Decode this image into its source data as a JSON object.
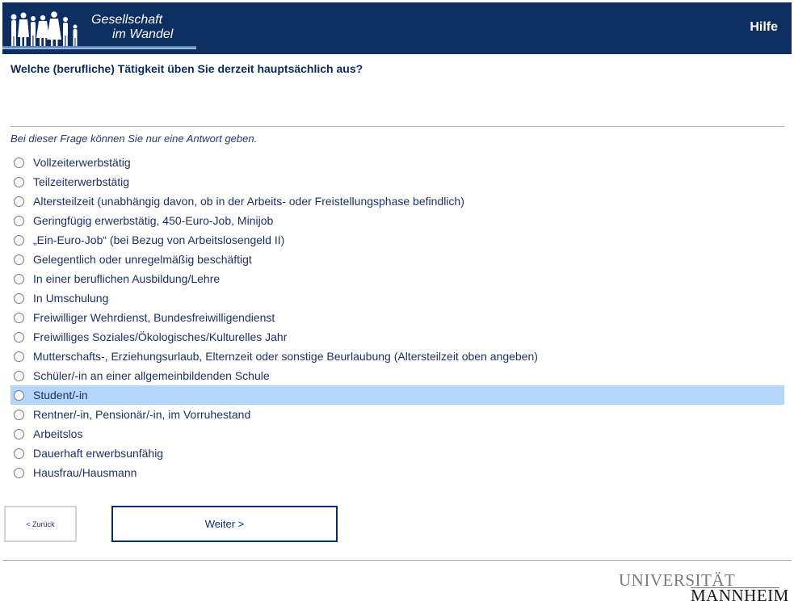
{
  "header": {
    "logo_line1": "Gesellschaft",
    "logo_line2": "im Wandel",
    "help_label": "Hilfe"
  },
  "question": {
    "text": "Welche (berufliche) Tätigkeit üben Sie derzeit hauptsächlich aus?",
    "instruction": "Bei dieser Frage können Sie nur eine Antwort geben."
  },
  "options": [
    {
      "label": "Vollzeiterwerbstätig"
    },
    {
      "label": "Teilzeiterwerbstätig"
    },
    {
      "label": "Altersteilzeit (unabhängig davon, ob in der Arbeits- oder Freistellungsphase befindlich)"
    },
    {
      "label": "Geringfügig erwerbstätig, 450-Euro-Job, Minijob"
    },
    {
      "label": "„Ein-Euro-Job“ (bei Bezug von Arbeitslosengeld II)"
    },
    {
      "label": "Gelegentlich oder unregelmäßig beschäftigt"
    },
    {
      "label": "In einer beruflichen Ausbildung/Lehre"
    },
    {
      "label": "In Umschulung"
    },
    {
      "label": "Freiwilliger Wehrdienst, Bundesfreiwilligendienst"
    },
    {
      "label": "Freiwilliges Soziales/Ökologisches/Kulturelles Jahr"
    },
    {
      "label": "Mutterschafts-, Erziehungsurlaub, Elternzeit oder sonstige Beurlaubung (Altersteilzeit oben angeben)"
    },
    {
      "label": "Schüler/-in an einer allgemeinbildenden Schule"
    },
    {
      "label": "Student/-in",
      "highlighted": true
    },
    {
      "label": "Rentner/-in, Pensionär/-in, im Vorruhestand"
    },
    {
      "label": "Arbeitslos"
    },
    {
      "label": "Dauerhaft erwerbsunfähig"
    },
    {
      "label": "Hausfrau/Hausmann"
    }
  ],
  "navigation": {
    "back_label": "< Zurück",
    "next_label": "Weiter >"
  },
  "footer": {
    "university_line1": "UNIVERSITÄT",
    "university_line2": "MANNHEIM"
  },
  "colors": {
    "header_bg": "#0d2e60",
    "highlight_row": "#b5d6fb",
    "text": "#1b2f5e"
  }
}
